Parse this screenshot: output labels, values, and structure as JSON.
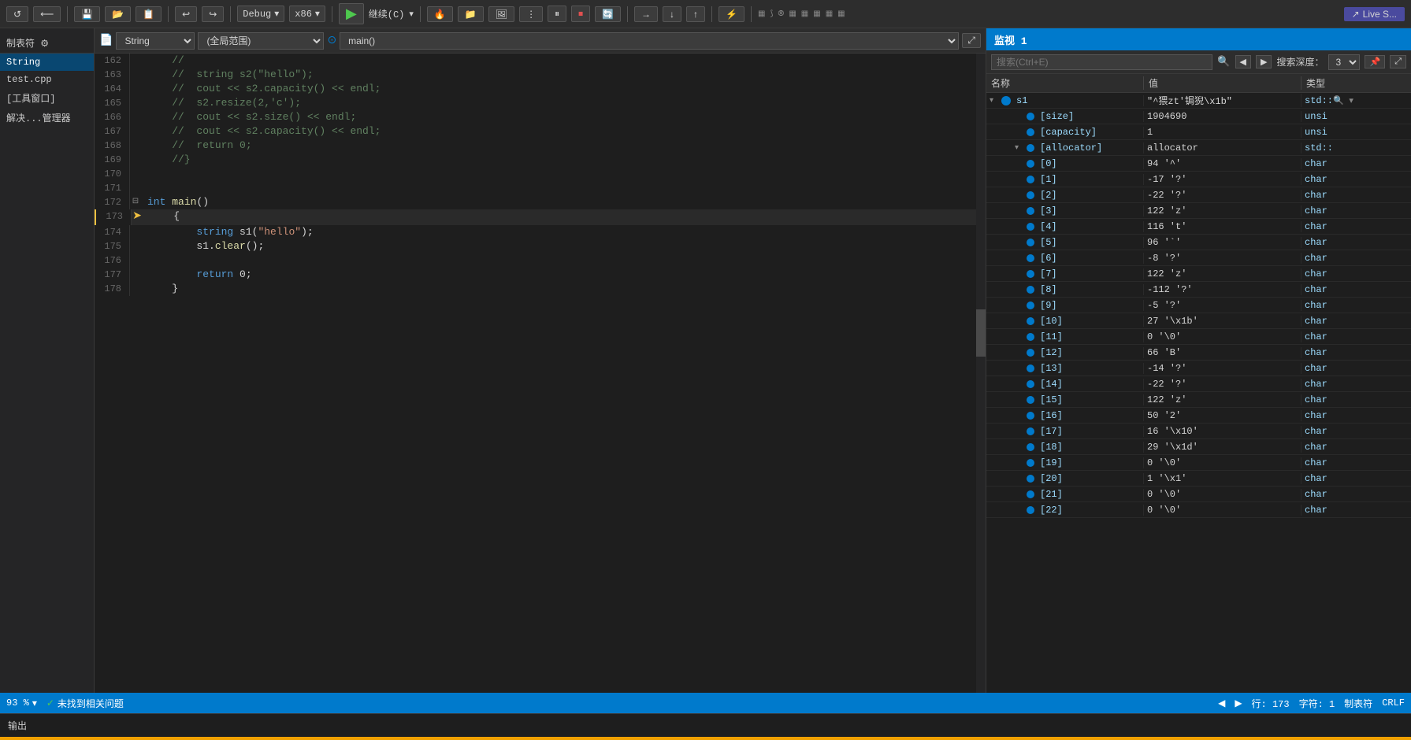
{
  "toolbar": {
    "debug_label": "Debug",
    "arch_label": "x86",
    "continue_label": "继续(C)",
    "live_share_label": "Live S..."
  },
  "sidebar": {
    "header": "制表符 ⚙",
    "items": [
      {
        "id": "string",
        "label": "String"
      },
      {
        "id": "test-cpp",
        "label": "test.cpp"
      },
      {
        "id": "tool-window",
        "label": "[工具窗口]"
      },
      {
        "id": "resolve-manager",
        "label": "解决...管理器"
      }
    ]
  },
  "editor": {
    "file_label": "String",
    "scope_label": "(全局范围)",
    "function_label": "main()",
    "lines": [
      {
        "num": 162,
        "text": "    //",
        "indent": 0,
        "type": "comment"
      },
      {
        "num": 163,
        "text": "    //  string s2(\"hello\");",
        "indent": 0,
        "type": "comment"
      },
      {
        "num": 164,
        "text": "    //  cout << s2.capacity() << endl;",
        "indent": 0,
        "type": "comment"
      },
      {
        "num": 165,
        "text": "    //  s2.resize(2,'c');",
        "indent": 0,
        "type": "comment"
      },
      {
        "num": 166,
        "text": "    //  cout << s2.size() << endl;",
        "indent": 0,
        "type": "comment"
      },
      {
        "num": 167,
        "text": "    //  cout << s2.capacity() << endl;",
        "indent": 0,
        "type": "comment"
      },
      {
        "num": 168,
        "text": "    //  return 0;",
        "indent": 0,
        "type": "comment"
      },
      {
        "num": 169,
        "text": "    //}",
        "indent": 0,
        "type": "comment"
      },
      {
        "num": 170,
        "text": "",
        "indent": 0,
        "type": "empty"
      },
      {
        "num": 171,
        "text": "",
        "indent": 0,
        "type": "empty"
      },
      {
        "num": 172,
        "text": "int main()",
        "indent": 0,
        "type": "function",
        "fold": "⊟"
      },
      {
        "num": 173,
        "text": "    {",
        "indent": 0,
        "type": "code",
        "current": true
      },
      {
        "num": 174,
        "text": "        string s1(\"hello\");",
        "indent": 0,
        "type": "code"
      },
      {
        "num": 175,
        "text": "        s1.clear();",
        "indent": 0,
        "type": "code"
      },
      {
        "num": 176,
        "text": "",
        "indent": 0,
        "type": "empty"
      },
      {
        "num": 177,
        "text": "        return 0;",
        "indent": 0,
        "type": "code"
      },
      {
        "num": 178,
        "text": "    }",
        "indent": 0,
        "type": "code"
      }
    ]
  },
  "watch": {
    "title": "监视 1",
    "search_placeholder": "搜索(Ctrl+E)",
    "search_depth_label": "搜索深度：",
    "search_depth_value": "3",
    "columns": {
      "name": "名称",
      "value": "值",
      "type": "类型"
    },
    "rows": [
      {
        "level": 0,
        "expanded": true,
        "name": "s1",
        "value": "\"^猥zt'锔猊\\x1b\"",
        "type": "std::",
        "has_children": true
      },
      {
        "level": 1,
        "expanded": false,
        "name": "[size]",
        "value": "1904690",
        "type": "unsi",
        "has_children": false
      },
      {
        "level": 1,
        "expanded": false,
        "name": "[capacity]",
        "value": "1",
        "type": "unsi",
        "has_children": false
      },
      {
        "level": 1,
        "expanded": true,
        "name": "[allocator]",
        "value": "allocator",
        "type": "std::",
        "has_children": true
      },
      {
        "level": 1,
        "expanded": false,
        "name": "[0]",
        "value": "94 '^'",
        "type": "char",
        "has_children": false
      },
      {
        "level": 1,
        "expanded": false,
        "name": "[1]",
        "value": "-17 '?'",
        "type": "char",
        "has_children": false
      },
      {
        "level": 1,
        "expanded": false,
        "name": "[2]",
        "value": "-22 '?'",
        "type": "char",
        "has_children": false
      },
      {
        "level": 1,
        "expanded": false,
        "name": "[3]",
        "value": "122 'z'",
        "type": "char",
        "has_children": false
      },
      {
        "level": 1,
        "expanded": false,
        "name": "[4]",
        "value": "116 't'",
        "type": "char",
        "has_children": false
      },
      {
        "level": 1,
        "expanded": false,
        "name": "[5]",
        "value": "96 '`'",
        "type": "char",
        "has_children": false
      },
      {
        "level": 1,
        "expanded": false,
        "name": "[6]",
        "value": "-8 '?'",
        "type": "char",
        "has_children": false
      },
      {
        "level": 1,
        "expanded": false,
        "name": "[7]",
        "value": "122 'z'",
        "type": "char",
        "has_children": false
      },
      {
        "level": 1,
        "expanded": false,
        "name": "[8]",
        "value": "-112 '?'",
        "type": "char",
        "has_children": false
      },
      {
        "level": 1,
        "expanded": false,
        "name": "[9]",
        "value": "-5 '?'",
        "type": "char",
        "has_children": false
      },
      {
        "level": 1,
        "expanded": false,
        "name": "[10]",
        "value": "27 '\\x1b'",
        "type": "char",
        "has_children": false
      },
      {
        "level": 1,
        "expanded": false,
        "name": "[11]",
        "value": "0 '\\0'",
        "type": "char",
        "has_children": false
      },
      {
        "level": 1,
        "expanded": false,
        "name": "[12]",
        "value": "66 'B'",
        "type": "char",
        "has_children": false
      },
      {
        "level": 1,
        "expanded": false,
        "name": "[13]",
        "value": "-14 '?'",
        "type": "char",
        "has_children": false
      },
      {
        "level": 1,
        "expanded": false,
        "name": "[14]",
        "value": "-22 '?'",
        "type": "char",
        "has_children": false
      },
      {
        "level": 1,
        "expanded": false,
        "name": "[15]",
        "value": "122 'z'",
        "type": "char",
        "has_children": false
      },
      {
        "level": 1,
        "expanded": false,
        "name": "[16]",
        "value": "50 '2'",
        "type": "char",
        "has_children": false
      },
      {
        "level": 1,
        "expanded": false,
        "name": "[17]",
        "value": "16 '\\x10'",
        "type": "char",
        "has_children": false
      },
      {
        "level": 1,
        "expanded": false,
        "name": "[18]",
        "value": "29 '\\x1d'",
        "type": "char",
        "has_children": false
      },
      {
        "level": 1,
        "expanded": false,
        "name": "[19]",
        "value": "0 '\\0'",
        "type": "char",
        "has_children": false
      },
      {
        "level": 1,
        "expanded": false,
        "name": "[20]",
        "value": "1 '\\x1'",
        "type": "char",
        "has_children": false
      },
      {
        "level": 1,
        "expanded": false,
        "name": "[21]",
        "value": "0 '\\0'",
        "type": "char",
        "has_children": false
      },
      {
        "level": 1,
        "expanded": false,
        "name": "[22]",
        "value": "0 '\\0'",
        "type": "char",
        "has_children": false
      }
    ]
  },
  "status_bar": {
    "zoom": "93 %",
    "no_issues": "未找到相关问题",
    "line": "行: 173",
    "col": "字符: 1",
    "encoding": "制表符",
    "line_ending": "CRLF"
  },
  "output_bar": {
    "label": "输出"
  }
}
